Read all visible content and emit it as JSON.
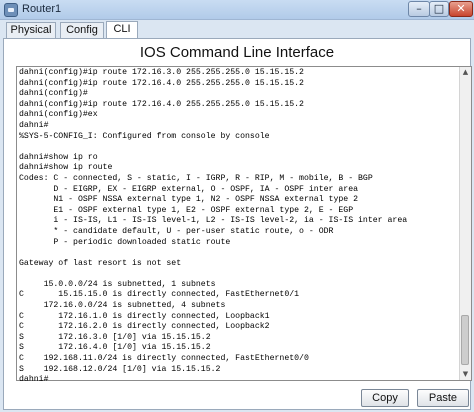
{
  "window": {
    "title": "Router1",
    "minimize": "–",
    "maximize": "□",
    "close": "✕"
  },
  "tabs": [
    {
      "label": "Physical"
    },
    {
      "label": "Config"
    },
    {
      "label": "CLI",
      "selected": true
    }
  ],
  "panel": {
    "title": "IOS Command Line Interface"
  },
  "console": {
    "lines": [
      "dahni(config)#ip route 172.16.3.0 255.255.255.0 15.15.15.2",
      "dahni(config)#ip route 172.16.4.0 255.255.255.0 15.15.15.2",
      "dahni(config)#",
      "dahni(config)#ip route 172.16.4.0 255.255.255.0 15.15.15.2",
      "dahni(config)#ex",
      "dahni#",
      "%SYS-5-CONFIG_I: Configured from console by console",
      "",
      "dahni#show ip ro",
      "dahni#show ip route",
      "Codes: C - connected, S - static, I - IGRP, R - RIP, M - mobile, B - BGP",
      "       D - EIGRP, EX - EIGRP external, O - OSPF, IA - OSPF inter area",
      "       N1 - OSPF NSSA external type 1, N2 - OSPF NSSA external type 2",
      "       E1 - OSPF external type 1, E2 - OSPF external type 2, E - EGP",
      "       i - IS-IS, L1 - IS-IS level-1, L2 - IS-IS level-2, ia - IS-IS inter area",
      "       * - candidate default, U - per-user static route, o - ODR",
      "       P - periodic downloaded static route",
      "",
      "Gateway of last resort is not set",
      "",
      "     15.0.0.0/24 is subnetted, 1 subnets",
      "C       15.15.15.0 is directly connected, FastEthernet0/1",
      "     172.16.0.0/24 is subnetted, 4 subnets",
      "C       172.16.1.0 is directly connected, Loopback1",
      "C       172.16.2.0 is directly connected, Loopback2",
      "S       172.16.3.0 [1/0] via 15.15.15.2",
      "S       172.16.4.0 [1/0] via 15.15.15.2",
      "C    192.168.11.0/24 is directly connected, FastEthernet0/0",
      "S    192.168.12.0/24 [1/0] via 15.15.15.2",
      "dahni#"
    ]
  },
  "buttons": {
    "copy": "Copy",
    "paste": "Paste"
  },
  "icons": {
    "app": "router-app-icon",
    "scroll_up": "▲",
    "scroll_down": "▼"
  }
}
